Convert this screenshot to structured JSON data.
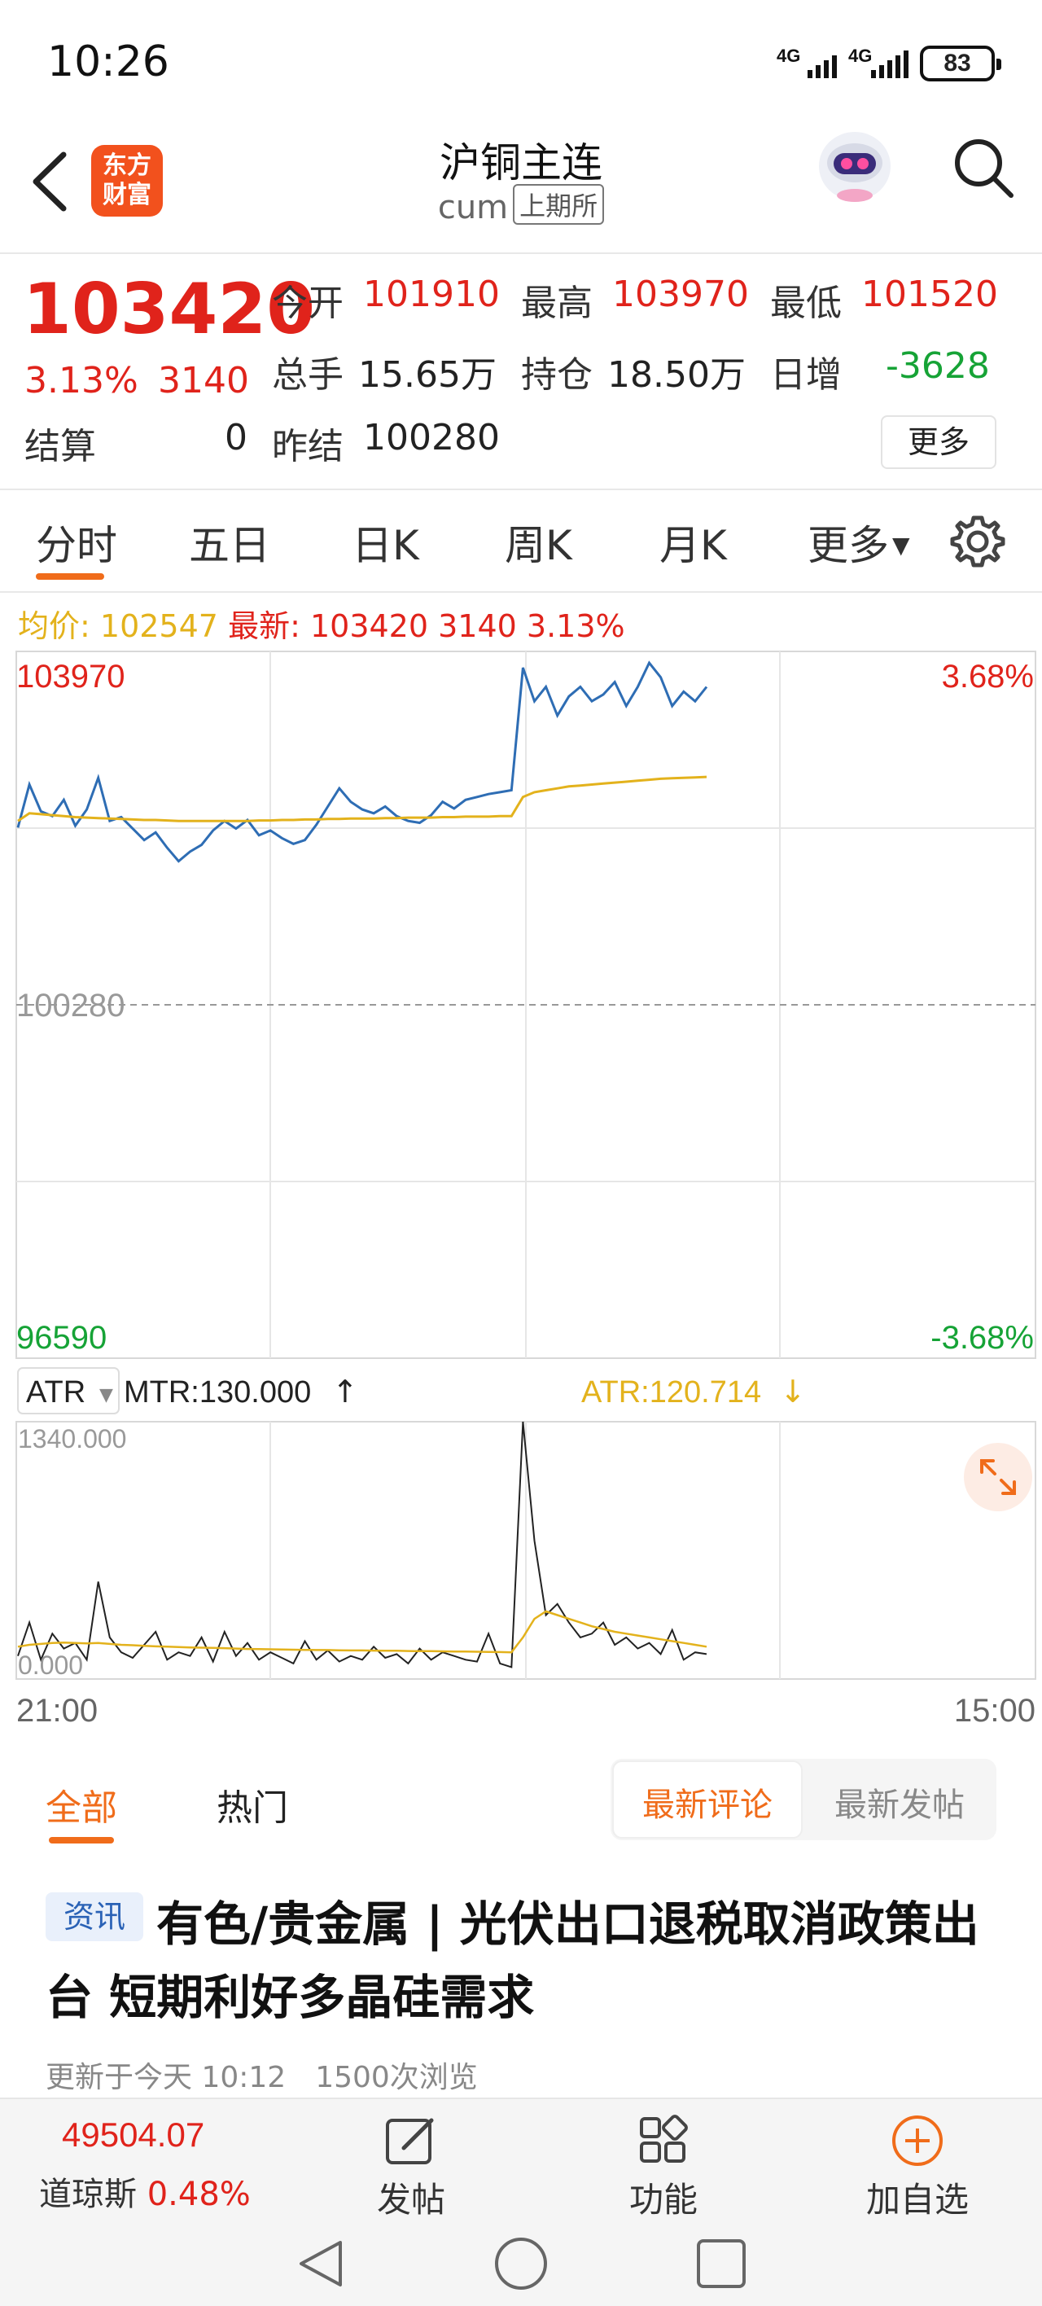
{
  "status_bar": {
    "time": "10:26",
    "sim1": "4G",
    "sim2": "4G",
    "battery": "83"
  },
  "header": {
    "logo_text_line1": "东方",
    "logo_text_line2": "财富",
    "title": "沪铜主连",
    "code": "cum",
    "exchange": "上期所"
  },
  "quote": {
    "price": "103420",
    "change_pct": "3.13%",
    "change": "3140",
    "open_label": "今开",
    "open": "101910",
    "high_label": "最高",
    "high": "103970",
    "low_label": "最低",
    "low": "101520",
    "volume_label": "总手",
    "volume": "15.65万",
    "oi_label": "持仓",
    "oi": "18.50万",
    "daily_inc_label": "日增",
    "daily_inc": "-3628",
    "settle_label": "结算",
    "settle": "0",
    "prev_settle_label": "昨结",
    "prev_settle": "100280",
    "more_label": "更多"
  },
  "tabs": {
    "t1": "分时",
    "t2": "五日",
    "t3": "日K",
    "t4": "周K",
    "t5": "月K",
    "t6": "更多"
  },
  "chart_info": {
    "avg_label": "均价:",
    "avg_value": "102547",
    "latest_label": "最新:",
    "latest_value": "103420 3140 3.13%"
  },
  "indicator": {
    "selector": "ATR",
    "mtr": "MTR:130.000",
    "atr": "ATR:120.714"
  },
  "chart_data": [
    {
      "type": "line",
      "title": "",
      "y_labels_left": [
        "103970",
        "100280",
        "96590"
      ],
      "y_labels_right": [
        "3.68%",
        "-3.68%"
      ],
      "x_labels": [
        "21:00",
        "15:00"
      ],
      "ylim": [
        96590,
        103970
      ],
      "reference_line": 100280,
      "grid": true,
      "series": [
        {
          "values": [
            102130,
            102580,
            102300,
            102250,
            102420,
            102150,
            102320,
            102650,
            102200,
            102240,
            102120,
            102000,
            102080,
            101920,
            101780,
            101880,
            101950,
            102100,
            102200,
            102120,
            102210,
            102050,
            102100,
            102020,
            101960,
            102000,
            102160,
            102350,
            102540,
            102400,
            102320,
            102280,
            102350,
            102250,
            102200,
            102180,
            102260,
            102400,
            102330,
            102420,
            102450,
            102480,
            102500,
            102520,
            103800,
            103450,
            103600,
            103300,
            103500,
            103600,
            103450,
            103520,
            103650,
            103400,
            103600,
            103850,
            103700,
            103400,
            103550,
            103450,
            103600
          ]
        },
        {
          "values": [
            102200,
            102280,
            102270,
            102260,
            102250,
            102240,
            102235,
            102230,
            102225,
            102220,
            102215,
            102210,
            102210,
            102205,
            102200,
            102200,
            102200,
            102200,
            102200,
            102200,
            102200,
            102205,
            102205,
            102210,
            102210,
            102215,
            102215,
            102220,
            102220,
            102225,
            102225,
            102225,
            102230,
            102230,
            102235,
            102235,
            102235,
            102240,
            102240,
            102245,
            102245,
            102245,
            102250,
            102250,
            102450,
            102500,
            102520,
            102540,
            102560,
            102570,
            102580,
            102590,
            102600,
            102610,
            102620,
            102630,
            102640,
            102645,
            102650,
            102655,
            102660
          ]
        }
      ]
    },
    {
      "type": "line",
      "title": "",
      "y_labels_left": [
        "1340.000",
        "0.000"
      ],
      "ylim": [
        0,
        1340
      ],
      "grid": true,
      "series": [
        {
          "values": [
            80,
            260,
            60,
            200,
            120,
            150,
            60,
            480,
            180,
            100,
            70,
            140,
            210,
            60,
            100,
            80,
            180,
            50,
            210,
            80,
            150,
            60,
            100,
            70,
            40,
            160,
            60,
            110,
            50,
            80,
            60,
            130,
            70,
            90,
            40,
            120,
            60,
            100,
            80,
            60,
            50,
            200,
            40,
            20,
            1340,
            700,
            300,
            360,
            260,
            180,
            200,
            260,
            140,
            180,
            120,
            150,
            90,
            220,
            60,
            100,
            90
          ]
        },
        {
          "values": [
            130,
            140,
            145,
            150,
            152,
            150,
            148,
            150,
            145,
            140,
            138,
            135,
            132,
            130,
            128,
            126,
            125,
            124,
            122,
            120,
            118,
            117,
            116,
            115,
            114,
            113,
            112,
            112,
            111,
            110,
            110,
            109,
            108,
            108,
            107,
            106,
            106,
            105,
            104,
            104,
            103,
            102,
            101,
            100,
            180,
            280,
            320,
            300,
            280,
            260,
            240,
            225,
            210,
            200,
            190,
            180,
            170,
            160,
            150,
            140,
            130
          ]
        }
      ]
    }
  ],
  "comments": {
    "tab_all": "全部",
    "tab_hot": "热门",
    "seg_latest_comment": "最新评论",
    "seg_latest_post": "最新发帖"
  },
  "news": {
    "tag": "资讯",
    "title": "有色/贵金属 | 光伏出口退税取消政策出台 短期利好多晶硅需求",
    "meta": "更新于今天 10:12　1500次浏览"
  },
  "bottom_bar": {
    "index_value": "49504.07",
    "index_name": "道琼斯",
    "index_pct": "0.48%",
    "post": "发帖",
    "function": "功能",
    "add": "加自选"
  },
  "colors": {
    "up": "#e0231b",
    "down": "#16a336",
    "accent": "#f06c1a",
    "price_line": "#2e6db4",
    "avg_line": "#e3b21c"
  }
}
